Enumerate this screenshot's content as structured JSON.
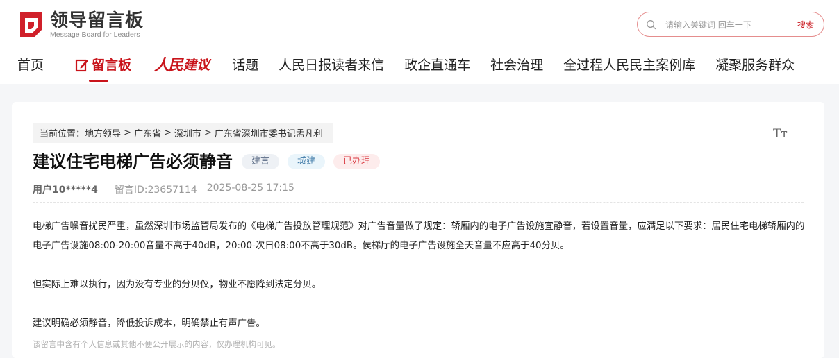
{
  "header": {
    "logo": {
      "title_cn": "领导留言板",
      "title_en": "Message Board for Leaders"
    },
    "search": {
      "placeholder": "请输入关键词 回车一下",
      "button": "搜索"
    },
    "nav": {
      "home": "首页",
      "board": "留言板",
      "renmin_script": "人民",
      "renmin_suffix": "建议",
      "topics": "话题",
      "readers": "人民日报读者来信",
      "govent": "政企直通车",
      "governance": "社会治理",
      "whole_process": "全过程人民民主案例库",
      "service": "凝聚服务群众"
    }
  },
  "breadcrumb": {
    "prefix": "当前位置：",
    "items": [
      "地方领导",
      "广东省",
      "深圳市",
      "广东省深圳市委书记孟凡利"
    ],
    "separator": ">"
  },
  "article": {
    "title": "建议住宅电梯广告必须静音",
    "tags": {
      "type": "建言",
      "field": "城建",
      "status": "已办理"
    },
    "user": "用户10*****4",
    "message_id": "留言ID:23657114",
    "datetime": "2025-08-25 17:15",
    "paragraphs": [
      "电梯广告噪音扰民严重，虽然深圳市场监管局发布的《电梯广告投放管理规范》对广告音量做了规定：轿厢内的电子广告设施宜静音，若设置音量，应满足以下要求：居民住宅电梯轿厢内的电子广告设施08:00-20:00音量不高于40dB，20:00-次日08:00不高于30dB。侯梯厅的电子广告设施全天音量不应高于40分贝。",
      "但实际上难以执行，因为没有专业的分贝仪，物业不愿降到法定分贝。",
      "建议明确必须静音，降低投诉成本，明确禁止有声广告。"
    ],
    "notice": "该留言中含有个人信息或其他不便公开展示的内容，仅办理机构可见。"
  },
  "icons": {
    "font_size": "font-size-icon",
    "font_size_glyph": "Tт",
    "search": "search-icon",
    "logo": "logo-mark-icon",
    "board": "edit-icon"
  },
  "colors": {
    "brand_red": "#c9141b",
    "tag_status": "#d9363e",
    "tag_field": "#3f7aa8"
  }
}
